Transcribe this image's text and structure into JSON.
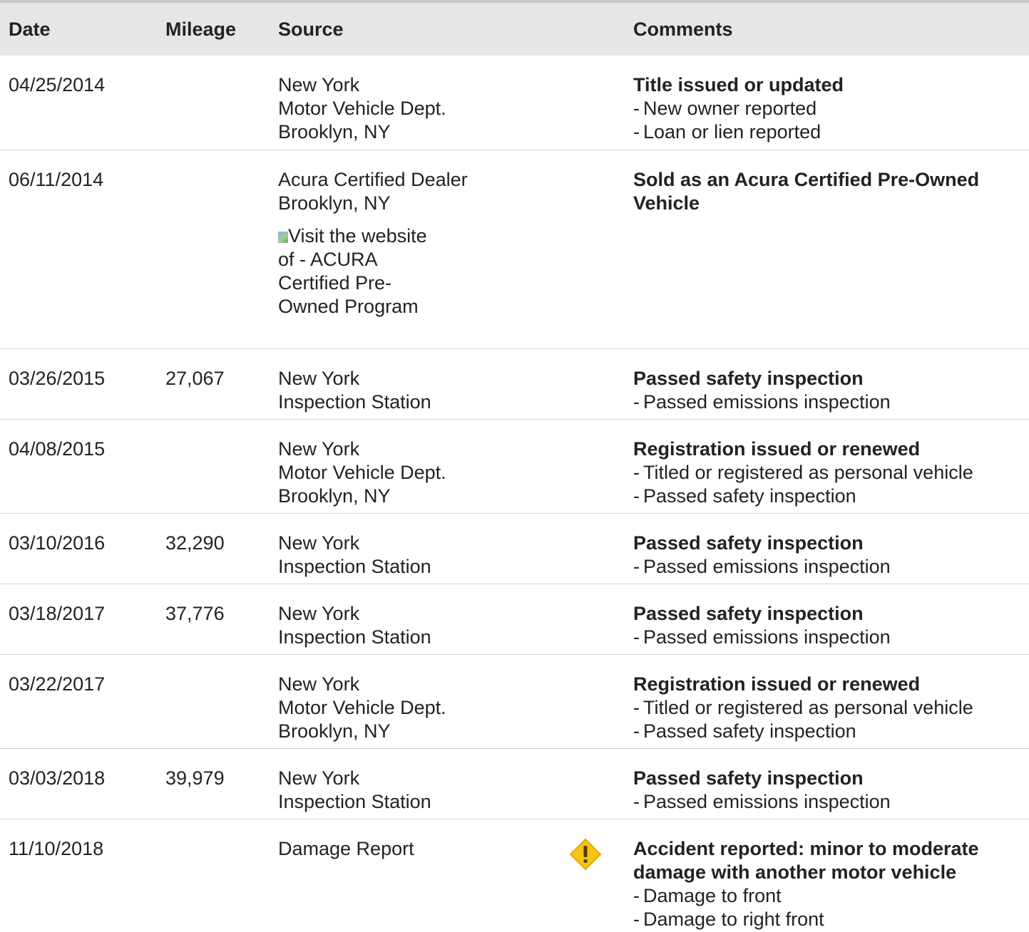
{
  "table": {
    "columns": {
      "date": "Date",
      "mileage": "Mileage",
      "source": "Source",
      "comments": "Comments"
    },
    "rows": [
      {
        "date": "04/25/2014",
        "mileage": "",
        "source": [
          "New York",
          "Motor Vehicle Dept.",
          "Brooklyn, NY"
        ],
        "comment_title": "Title issued or updated",
        "details": [
          "New owner reported",
          "Loan or lien reported"
        ]
      },
      {
        "date": "06/11/2014",
        "mileage": "",
        "source": [
          "Acura Certified Dealer",
          "Brooklyn, NY"
        ],
        "link_text": "Visit the website of - ACURA Certified Pre-Owned Program",
        "comment_title_lines": [
          "Sold as an Acura Certified Pre-Owned",
          "Vehicle"
        ],
        "details": []
      },
      {
        "date": "03/26/2015",
        "mileage": "27,067",
        "source": [
          "New York",
          "Inspection Station"
        ],
        "comment_title": "Passed safety inspection",
        "details": [
          "Passed emissions inspection"
        ]
      },
      {
        "date": "04/08/2015",
        "mileage": "",
        "source": [
          "New York",
          "Motor Vehicle Dept.",
          "Brooklyn, NY"
        ],
        "comment_title": "Registration issued or renewed",
        "details": [
          "Titled or registered as personal vehicle",
          "Passed safety inspection"
        ]
      },
      {
        "date": "03/10/2016",
        "mileage": "32,290",
        "source": [
          "New York",
          "Inspection Station"
        ],
        "comment_title": "Passed safety inspection",
        "details": [
          "Passed emissions inspection"
        ]
      },
      {
        "date": "03/18/2017",
        "mileage": "37,776",
        "source": [
          "New York",
          "Inspection Station"
        ],
        "comment_title": "Passed safety inspection",
        "details": [
          "Passed emissions inspection"
        ]
      },
      {
        "date": "03/22/2017",
        "mileage": "",
        "source": [
          "New York",
          "Motor Vehicle Dept.",
          "Brooklyn, NY"
        ],
        "comment_title": "Registration issued or renewed",
        "details": [
          "Titled or registered as personal vehicle",
          "Passed safety inspection"
        ]
      },
      {
        "date": "03/03/2018",
        "mileage": "39,979",
        "source": [
          "New York",
          "Inspection Station"
        ],
        "comment_title": "Passed safety inspection",
        "details": [
          "Passed emissions inspection"
        ]
      },
      {
        "date": "11/10/2018",
        "mileage": "",
        "source": [
          "Damage Report"
        ],
        "icon": "warning-icon",
        "comment_title_lines": [
          "Accident reported: minor to moderate",
          "damage with another motor vehicle"
        ],
        "details": [
          "Damage to front",
          "Damage to right front"
        ]
      }
    ]
  },
  "colors": {
    "header_bg": "#e6e6e6",
    "row_divider": "#d6d6d6",
    "warning_fill": "#f5c518",
    "warning_border": "#e6a800"
  },
  "detail_dash": "-"
}
